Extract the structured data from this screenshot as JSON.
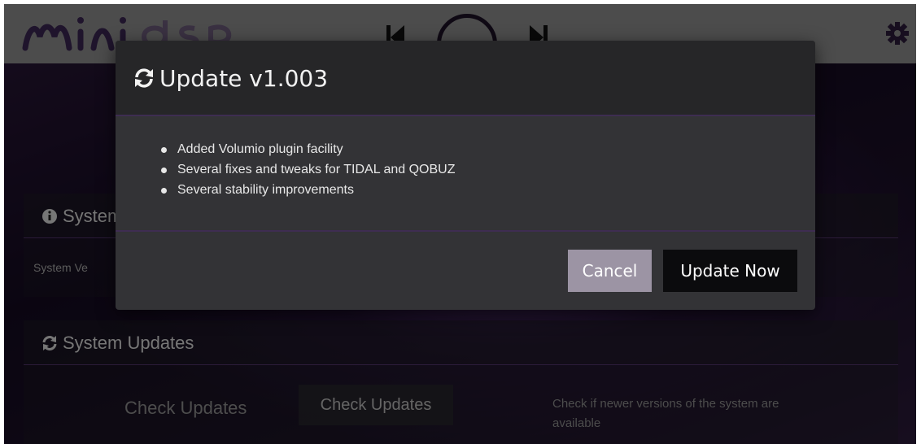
{
  "app": {
    "brand_logo": "minidsp",
    "colors": {
      "topbar": "#8a8a8a",
      "accent_purple": "#3e2d52",
      "cancel_button": "#9c94a4",
      "update_button": "#0b0b0d"
    }
  },
  "topbar": {
    "icons": [
      "previous-icon",
      "play-icon",
      "next-icon",
      "gear-icon"
    ]
  },
  "background": {
    "system_info": {
      "title": "System",
      "version_label": "System Ve"
    },
    "system_updates": {
      "title": "System Updates",
      "check_label": "Check Updates",
      "check_button": "Check Updates",
      "help_text": "Check if newer versions of the system are available"
    }
  },
  "modal": {
    "title": "Update v1.003",
    "changes": [
      "Added Volumio plugin facility",
      "Several fixes and tweaks for TIDAL and QOBUZ",
      "Several stability improvements"
    ],
    "cancel_label": "Cancel",
    "update_label": "Update Now"
  }
}
